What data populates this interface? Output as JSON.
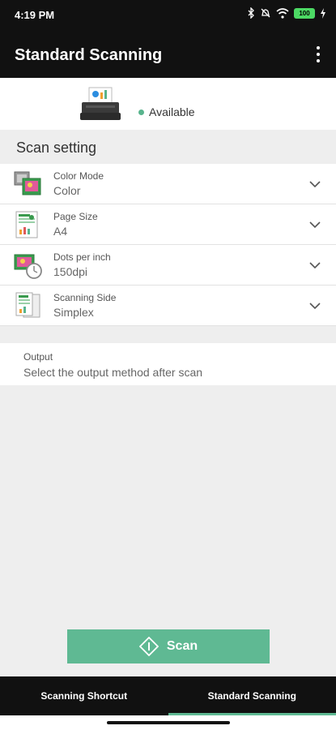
{
  "status_bar": {
    "time": "4:19 PM",
    "battery": "100",
    "icons": [
      "bluetooth-icon",
      "mute-icon",
      "wifi-icon",
      "battery-icon",
      "charging-icon"
    ]
  },
  "app_bar": {
    "title": "Standard Scanning",
    "menu_icon": "more-vertical-icon"
  },
  "scanner": {
    "status": "Available",
    "status_color": "#58b48d"
  },
  "scan_setting": {
    "title": "Scan setting",
    "items": [
      {
        "label": "Color Mode",
        "value": "Color",
        "icon": "color-mode-icon"
      },
      {
        "label": "Page Size",
        "value": "A4",
        "icon": "page-size-icon"
      },
      {
        "label": "Dots per inch",
        "value": "150dpi",
        "icon": "resolution-icon"
      },
      {
        "label": "Scanning Side",
        "value": "Simplex",
        "icon": "scanning-side-icon"
      }
    ]
  },
  "output": {
    "label": "Output",
    "description": "Select the output method after scan"
  },
  "scan_button": {
    "label": "Scan",
    "color": "#5fb993"
  },
  "bottom_nav": {
    "tabs": [
      {
        "label": "Scanning Shortcut",
        "active": false
      },
      {
        "label": "Standard Scanning",
        "active": true
      }
    ],
    "accent": "#5fb993"
  }
}
